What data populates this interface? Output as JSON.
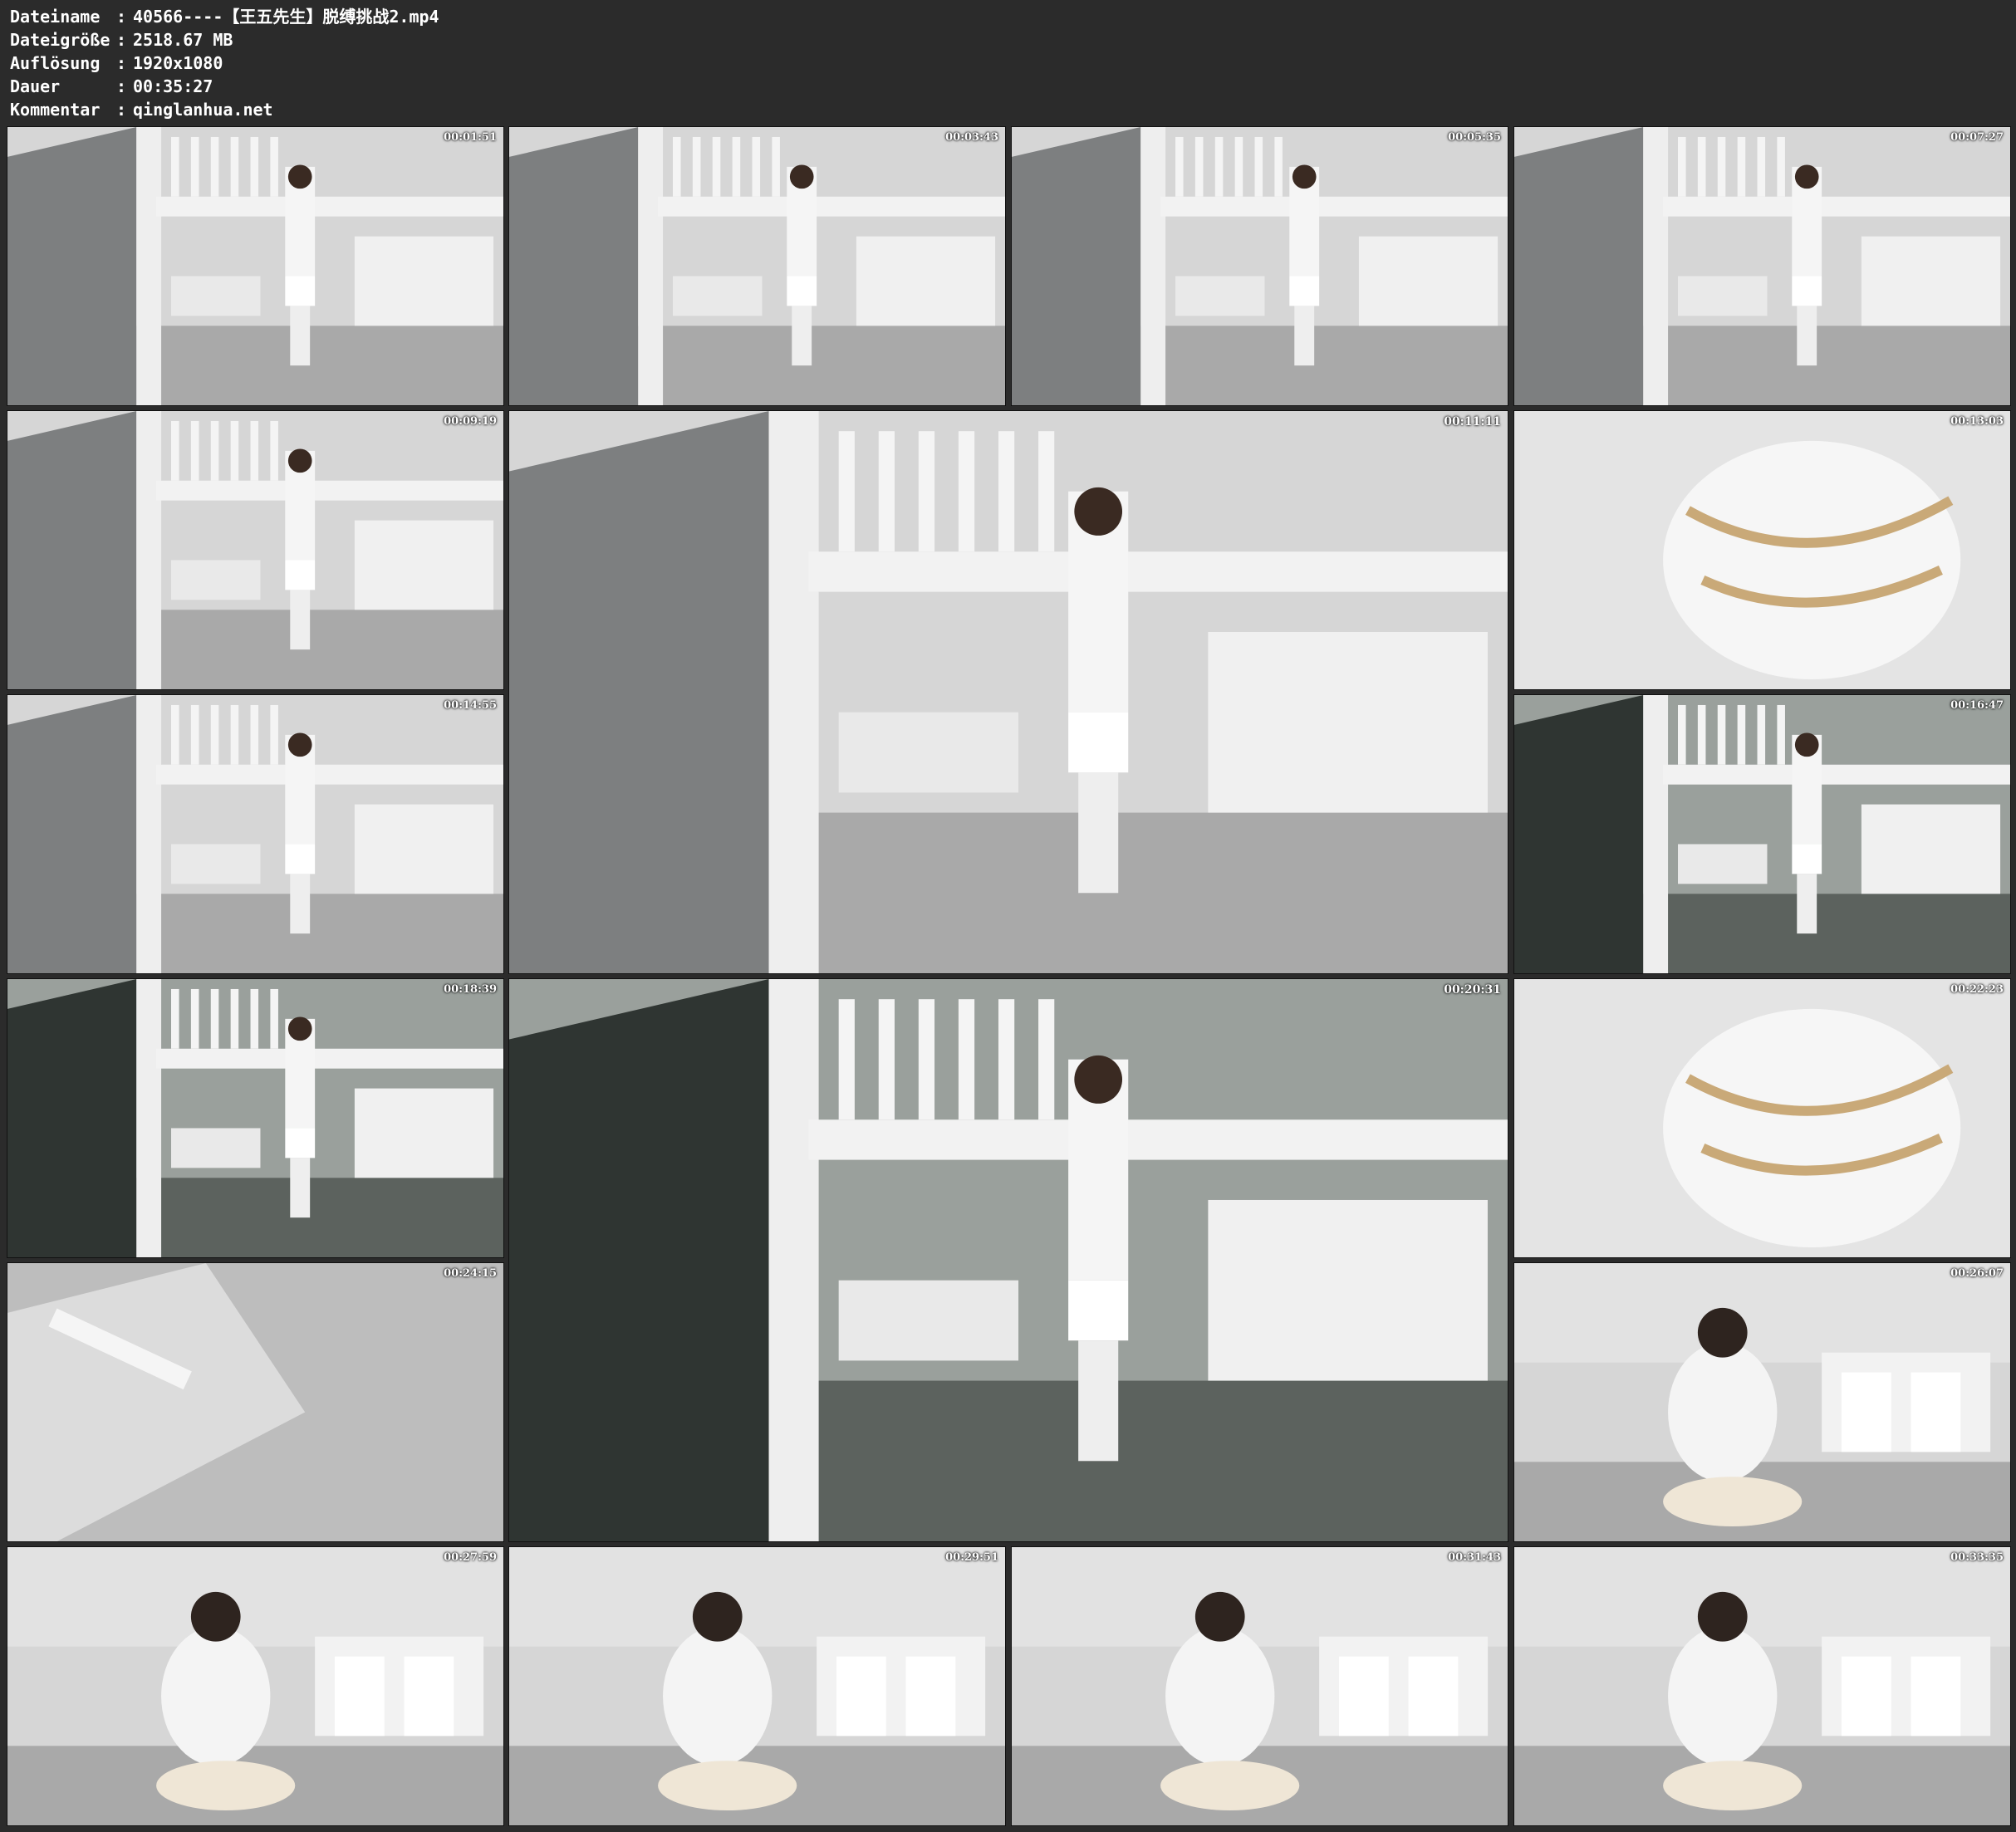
{
  "info": [
    {
      "key": "Dateiname",
      "sep": ":",
      "value": "40566----【王五先生】脱缚挑战2.mp4"
    },
    {
      "key": "Dateigröße",
      "sep": ":",
      "value": "2518.67 MB"
    },
    {
      "key": "Auflösung",
      "sep": ":",
      "value": "1920x1080"
    },
    {
      "key": "Dauer",
      "sep": ":",
      "value": "00:35:27"
    },
    {
      "key": "Kommentar",
      "sep": ":",
      "value": "qinglanhua.net"
    }
  ],
  "thumbnails": [
    {
      "timestamp": "00:01:51",
      "scene": "standing-stairs",
      "tone": "light"
    },
    {
      "timestamp": "00:03:43",
      "scene": "standing-stairs",
      "tone": "light"
    },
    {
      "timestamp": "00:05:35",
      "scene": "standing-stairs",
      "tone": "light"
    },
    {
      "timestamp": "00:07:27",
      "scene": "standing-stairs",
      "tone": "light"
    },
    {
      "timestamp": "00:09:19",
      "scene": "standing-stairs",
      "tone": "light"
    },
    {
      "timestamp": "00:11:11",
      "scene": "standing-stairs",
      "tone": "light"
    },
    {
      "timestamp": "00:13:03",
      "scene": "closeup",
      "tone": "light"
    },
    {
      "timestamp": "00:14:55",
      "scene": "standing-stairs",
      "tone": "light"
    },
    {
      "timestamp": "00:16:47",
      "scene": "standing-stairs",
      "tone": "dark"
    },
    {
      "timestamp": "00:18:39",
      "scene": "standing-stairs",
      "tone": "dark"
    },
    {
      "timestamp": "00:20:31",
      "scene": "standing-stairs",
      "tone": "dark"
    },
    {
      "timestamp": "00:22:23",
      "scene": "closeup",
      "tone": "light"
    },
    {
      "timestamp": "00:24:15",
      "scene": "floor",
      "tone": "light"
    },
    {
      "timestamp": "00:26:07",
      "scene": "kneeling",
      "tone": "light"
    },
    {
      "timestamp": "00:27:59",
      "scene": "kneeling",
      "tone": "light"
    },
    {
      "timestamp": "00:29:51",
      "scene": "kneeling",
      "tone": "light"
    },
    {
      "timestamp": "00:31:43",
      "scene": "kneeling",
      "tone": "light"
    },
    {
      "timestamp": "00:33:35",
      "scene": "kneeling",
      "tone": "light"
    }
  ]
}
